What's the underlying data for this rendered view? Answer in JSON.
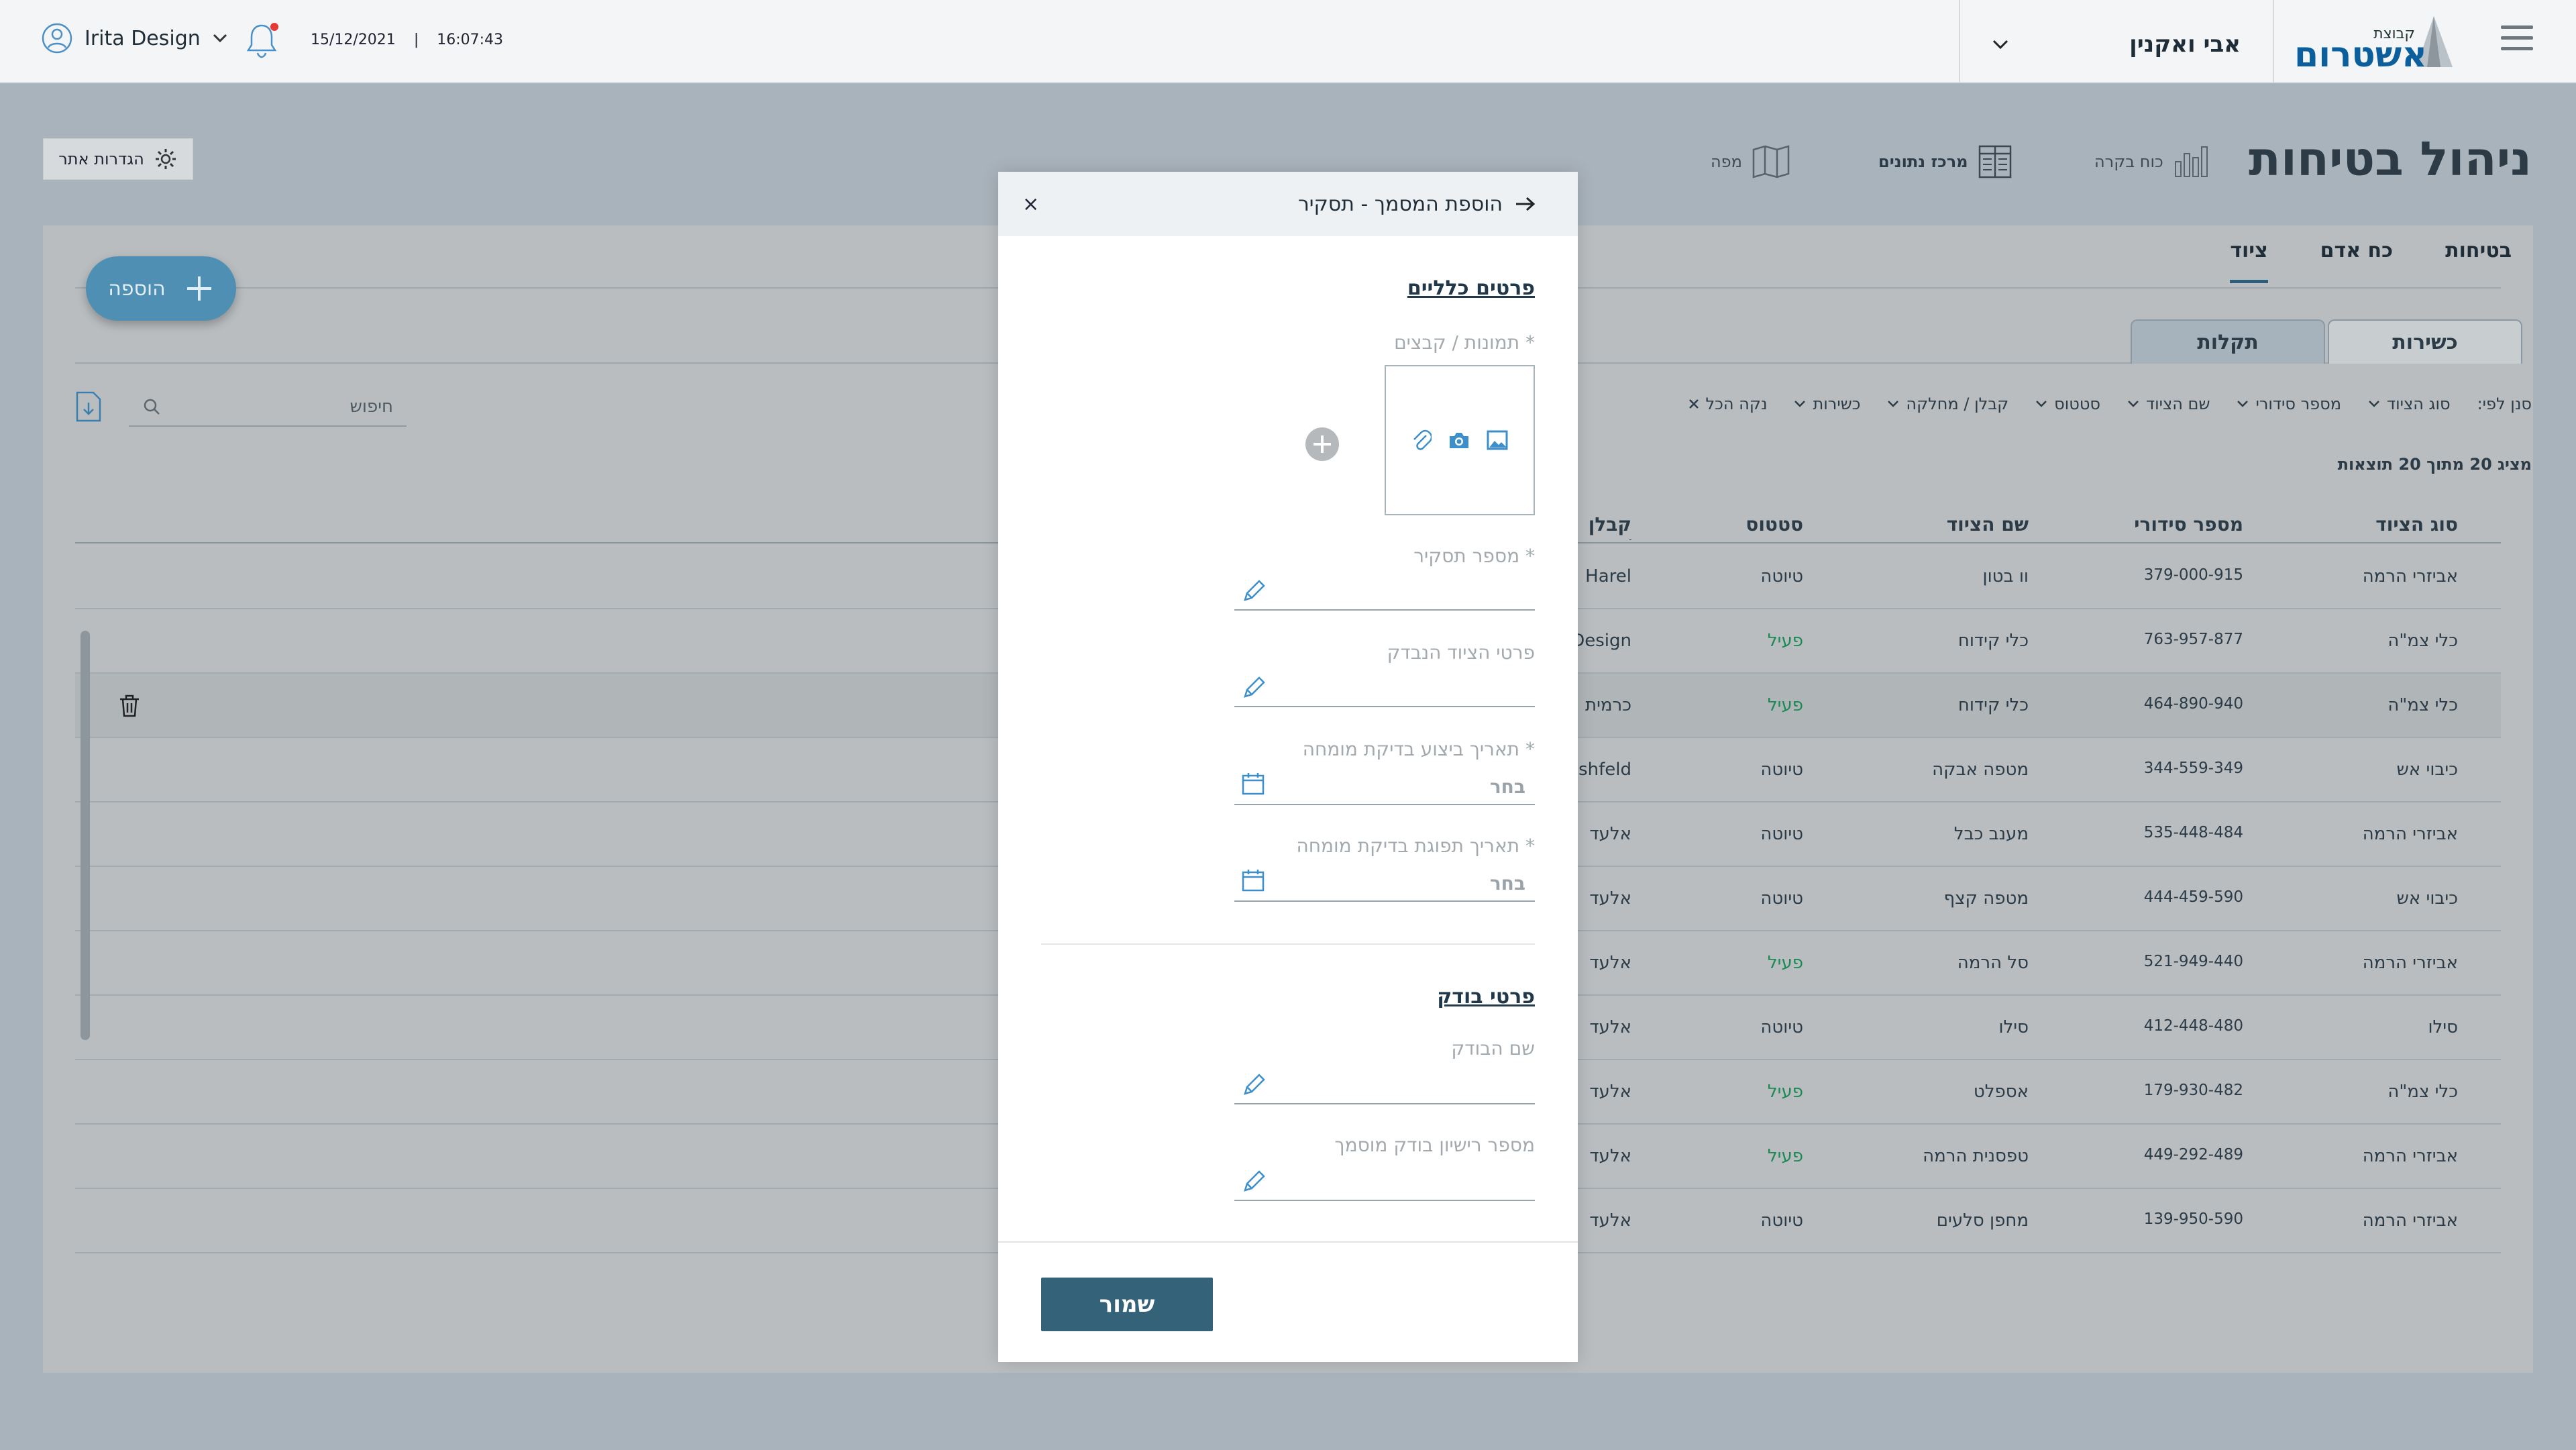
{
  "topbar": {
    "user_name": "Irita Design",
    "date": "15/12/2021",
    "time_separator": "|",
    "time": "16:07:43",
    "person_select": "אבי ואקנין",
    "logo_small": "קבוצת",
    "logo_main": "אשטרום"
  },
  "page": {
    "title": "ניהול בטיחות",
    "quick_nav": {
      "inspection": "כוח בקרה",
      "data_center": "מרכז נתונים",
      "map": "מפה"
    },
    "settings_label": "הגדרות אתר"
  },
  "tabs": [
    "בטיחות",
    "כח אדם",
    "ציוד"
  ],
  "add_label": "הוספה",
  "subtabs": [
    "כשירות",
    "תקלות"
  ],
  "filters": {
    "prefix": "סנן לפי:",
    "items": [
      "סוג הציוד",
      "מספר סידורי",
      "שם הציוד",
      "סטטוס",
      "קבלן / מחלקה",
      "כשירות"
    ],
    "clear": "נקה הכל"
  },
  "results_count": "מציג 20 מתוך 20 תוצאות",
  "search_placeholder": "חיפוש",
  "table": {
    "headers": [
      "סוג הציוד",
      "מספר סידורי",
      "שם הציוד",
      "סטטוס",
      "קבלן /"
    ],
    "rows": [
      [
        "אביזרי הרמה",
        "379-000-915",
        "וו בטון",
        "טיוטה",
        "Harel"
      ],
      [
        "כלי צמ\"ה",
        "763-957-877",
        "כלי קידוח",
        "פעיל",
        "Design"
      ],
      [
        "כלי צמ\"ה",
        "464-890-940",
        "כלי קידוח",
        "פעיל",
        "כרמית"
      ],
      [
        "כיבוי אש",
        "344-559-349",
        "מטפה אבקה",
        "טיוטה",
        "shfeld"
      ],
      [
        "אביזרי הרמה",
        "535-448-484",
        "מענב כבל",
        "טיוטה",
        "אלעד"
      ],
      [
        "כיבוי אש",
        "444-459-590",
        "מטפה קצף",
        "טיוטה",
        "אלעד"
      ],
      [
        "אביזרי הרמה",
        "521-949-440",
        "סל הרמה",
        "פעיל",
        "אלעד"
      ],
      [
        "סילו",
        "412-448-480",
        "סילו",
        "טיוטה",
        "אלעד"
      ],
      [
        "כלי צמ\"ה",
        "179-930-482",
        "אספלט",
        "פעיל",
        "אלעד"
      ],
      [
        "אביזרי הרמה",
        "449-292-489",
        "טפסנית הרמה",
        "פעיל",
        "אלעד"
      ],
      [
        "אביזרי הרמה",
        "139-950-590",
        "מחפן סלעים",
        "טיוטה",
        "אלעד"
      ]
    ]
  },
  "modal": {
    "title": "הוספת המסמך - תסקיר",
    "close": "×",
    "section_general": "פרטים כלליים",
    "photos_label": "תמונות / קבצים *",
    "report_number_label": "מספר תסקיר *",
    "equipment_details_label": "פרטי הציוד הנבדק",
    "exec_date_label": "תאריך ביצוע בדיקת מומחה *",
    "expiry_date_label": "תאריך תפוגת בדיקת מומחה *",
    "date_placeholder": "בחר",
    "section_inspector": "פרטי בודק",
    "inspector_name_label": "שם הבודק",
    "inspector_license_label": "מספר רישיון בודק מוסמך",
    "save_label": "שמור"
  },
  "colors": {
    "accent": "#346278",
    "active_status": "#1c8a55",
    "add_button": "#4f8fb3"
  }
}
